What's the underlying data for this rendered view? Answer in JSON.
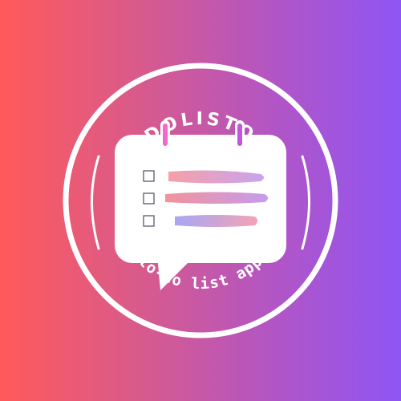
{
  "logo": {
    "brand_name": "DOLISTO",
    "tagline": "to-do list app",
    "colors": {
      "gradient_left": "#ff5a5a",
      "gradient_right": "#8f55f5",
      "ring": "#ffffff",
      "card": "#ffffff",
      "ring_pin": "#f06acb",
      "checkbox_outline": "#4a4a6a"
    },
    "tasks": [
      {
        "checked": false,
        "bar_from": "#f6a0a8",
        "bar_to": "#c8a3ee"
      },
      {
        "checked": false,
        "bar_from": "#f2939a",
        "bar_to": "#c59cec"
      },
      {
        "checked": false,
        "bar_from": "#a8a6f2",
        "bar_to": "#f2a3b6"
      }
    ]
  }
}
